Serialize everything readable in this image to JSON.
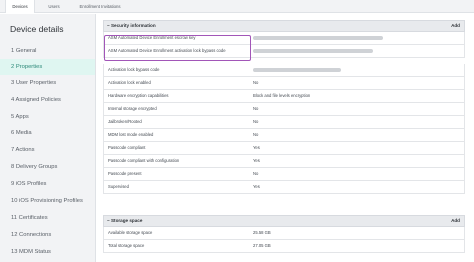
{
  "tabs": [
    {
      "label": "Devices"
    },
    {
      "label": "Users"
    },
    {
      "label": "Enrollment Invitations"
    }
  ],
  "sidebar": {
    "title": "Device details",
    "items": [
      {
        "label": "1  General"
      },
      {
        "label": "2  Properties"
      },
      {
        "label": "3  User Properties"
      },
      {
        "label": "4  Assigned Policies"
      },
      {
        "label": "5  Apps"
      },
      {
        "label": "6  Media"
      },
      {
        "label": "7  Actions"
      },
      {
        "label": "8  Delivery Groups"
      },
      {
        "label": "9  iOS Profiles"
      },
      {
        "label": "10  iOS Provisioning Profiles"
      },
      {
        "label": "11  Certificates"
      },
      {
        "label": "12  Connections"
      },
      {
        "label": "13  MDM Status"
      }
    ]
  },
  "security": {
    "title": "Security information",
    "add_label": "Add",
    "rows": [
      {
        "label": "ASM Automated Device Enrollment escrow key",
        "value": ""
      },
      {
        "label": "ASM Automated Device Enrollment activation lock bypass code",
        "value": ""
      },
      {
        "label": "Activation lock bypass code",
        "value": ""
      },
      {
        "label": "Activation lock enabled",
        "value": "No"
      },
      {
        "label": "Hardware encryption capabilities",
        "value": "Block and file levels encryption"
      },
      {
        "label": "Internal storage encrypted",
        "value": "No"
      },
      {
        "label": "Jailbroken/Rooted",
        "value": "No"
      },
      {
        "label": "MDM lost mode enabled",
        "value": "No"
      },
      {
        "label": "Passcode compliant",
        "value": "Yes"
      },
      {
        "label": "Passcode compliant with configuration",
        "value": "Yes"
      },
      {
        "label": "Passcode present",
        "value": "No"
      },
      {
        "label": "Supervised",
        "value": "Yes"
      }
    ]
  },
  "storage": {
    "title": "Storage space",
    "add_label": "Add",
    "rows": [
      {
        "label": "Available storage space",
        "value": "25.58 GB"
      },
      {
        "label": "Total storage space",
        "value": "27.05 GB"
      }
    ]
  },
  "colors": {
    "accent": "#2d8a79",
    "highlight": "#a256b8"
  }
}
